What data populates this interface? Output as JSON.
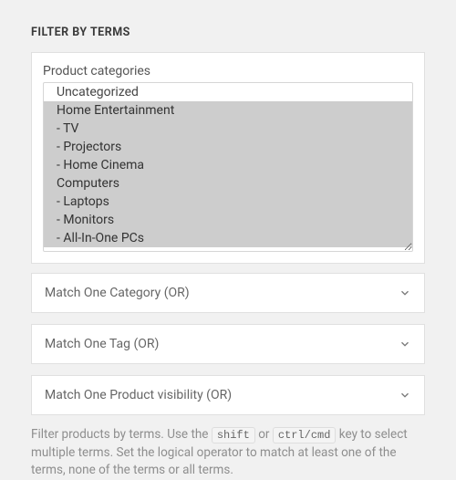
{
  "title": "FILTER BY TERMS",
  "card": {
    "label": "Product categories",
    "options": [
      {
        "label": "Uncategorized",
        "selected": false
      },
      {
        "label": "Home Entertainment",
        "selected": true
      },
      {
        "label": "- TV",
        "selected": true
      },
      {
        "label": "- Projectors",
        "selected": true
      },
      {
        "label": "- Home Cinema",
        "selected": true
      },
      {
        "label": "Computers",
        "selected": true
      },
      {
        "label": "- Laptops",
        "selected": true
      },
      {
        "label": "- Monitors",
        "selected": true
      },
      {
        "label": "- All-In-One PCs",
        "selected": true
      }
    ]
  },
  "dropdowns": {
    "category": "Match One Category (OR)",
    "tag": "Match One Tag (OR)",
    "visibility": "Match One Product visibility (OR)"
  },
  "help": {
    "pre": "Filter products by terms. Use the ",
    "kbd1": "shift",
    "mid": " or ",
    "kbd2": "ctrl/cmd",
    "post": " key to select multiple terms. Set the logical operator to match at least one of the terms, none of the terms or all terms."
  }
}
